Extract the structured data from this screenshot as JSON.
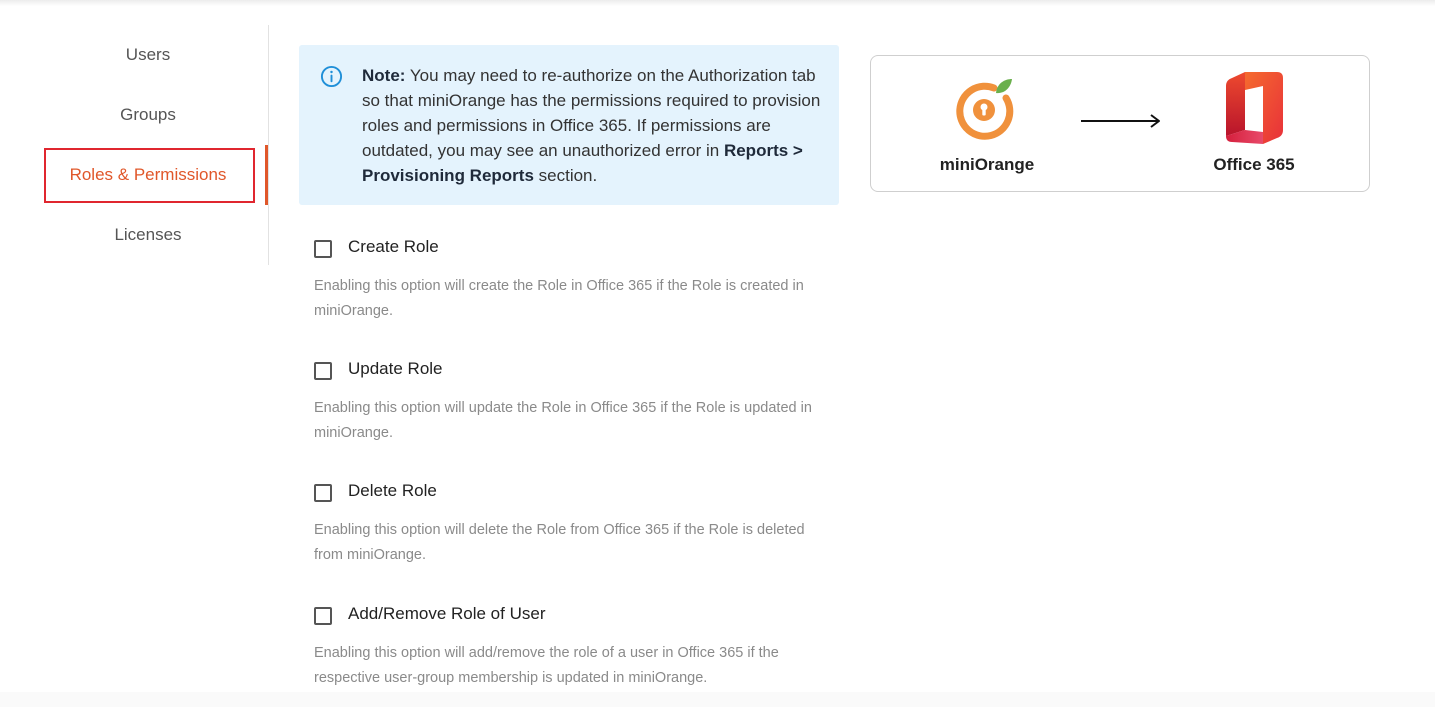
{
  "sidebar": {
    "items": [
      {
        "label": "Users",
        "active": false
      },
      {
        "label": "Groups",
        "active": false
      },
      {
        "label": "Roles & Permissions",
        "active": true
      },
      {
        "label": "Licenses",
        "active": false
      }
    ]
  },
  "note": {
    "icon": "info-icon",
    "label": "Note:",
    "text_1": " You may need to re-authorize on the Authorization tab so that miniOrange has the permissions required to provision roles and permissions in Office 365. If permissions are outdated, you may see an unauthorized error in ",
    "link_text": "Reports > Provisioning Reports",
    "text_2": " section."
  },
  "options": [
    {
      "title": "Create Role",
      "checked": false,
      "description": "Enabling this option will create the Role in Office 365 if the Role is created in miniOrange."
    },
    {
      "title": "Update Role",
      "checked": false,
      "description": "Enabling this option will update the Role in Office 365 if the Role is updated in miniOrange."
    },
    {
      "title": "Delete Role",
      "checked": false,
      "description": "Enabling this option will delete the Role from Office 365 if the Role is deleted from miniOrange."
    },
    {
      "title": "Add/Remove Role of User",
      "checked": false,
      "description": "Enabling this option will add/remove the role of a user in Office 365 if the respective user-group membership is updated in miniOrange."
    }
  ],
  "integration_card": {
    "source_name": "miniOrange",
    "target_name": "Office 365",
    "source_icon": "miniorange-logo",
    "arrow_icon": "arrow-right-icon",
    "target_icon": "office365-logo"
  },
  "colors": {
    "accent": "#e0572a",
    "highlight_border": "#e0262f",
    "note_bg": "#e4f3fd",
    "info_icon": "#1f8fd8"
  }
}
